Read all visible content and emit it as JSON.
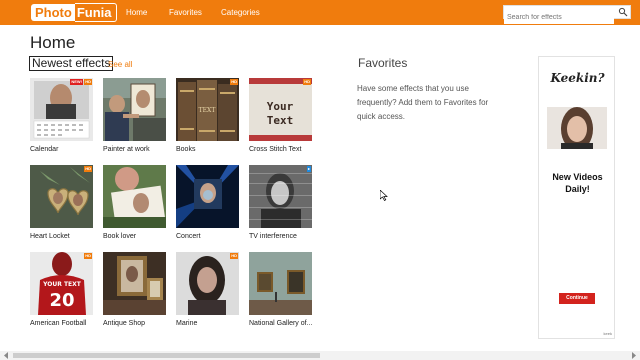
{
  "header": {
    "logo_part1": "Photo",
    "logo_part2": "Funia",
    "nav": [
      "Home",
      "Favorites",
      "Categories"
    ],
    "search_placeholder": "Search for effects"
  },
  "page": {
    "title": "Home",
    "section_title": "Newest effects",
    "see_all": "See all"
  },
  "effects": [
    {
      "label": "Calendar",
      "badge": "HD",
      "new": "NEW!"
    },
    {
      "label": "Painter at work"
    },
    {
      "label": "Books",
      "badge": "HD"
    },
    {
      "label": "Cross Stitch Text",
      "badge": "HD"
    },
    {
      "label": "Heart Locket",
      "badge": "HD"
    },
    {
      "label": "Book lover"
    },
    {
      "label": "Concert"
    },
    {
      "label": "TV interference"
    },
    {
      "label": "American Football",
      "badge": "HD"
    },
    {
      "label": "Antique Shop"
    },
    {
      "label": "Marine",
      "badge": "HD"
    },
    {
      "label": "National Gallery of..."
    }
  ],
  "thumb_text": {
    "cross_stitch": "Your Text",
    "books": "TEXT",
    "football_name": "YOUR TEXT",
    "football_number": "20"
  },
  "favorites": {
    "title": "Favorites",
    "text": "Have some effects that you use frequently? Add them to Favorites for quick access."
  },
  "ad": {
    "brand": "Keekin?",
    "headline": "New Videos Daily!",
    "button": "Continue",
    "footer": "keek"
  },
  "colors": {
    "accent": "#f07c0d",
    "ad_button": "#d3231d"
  }
}
